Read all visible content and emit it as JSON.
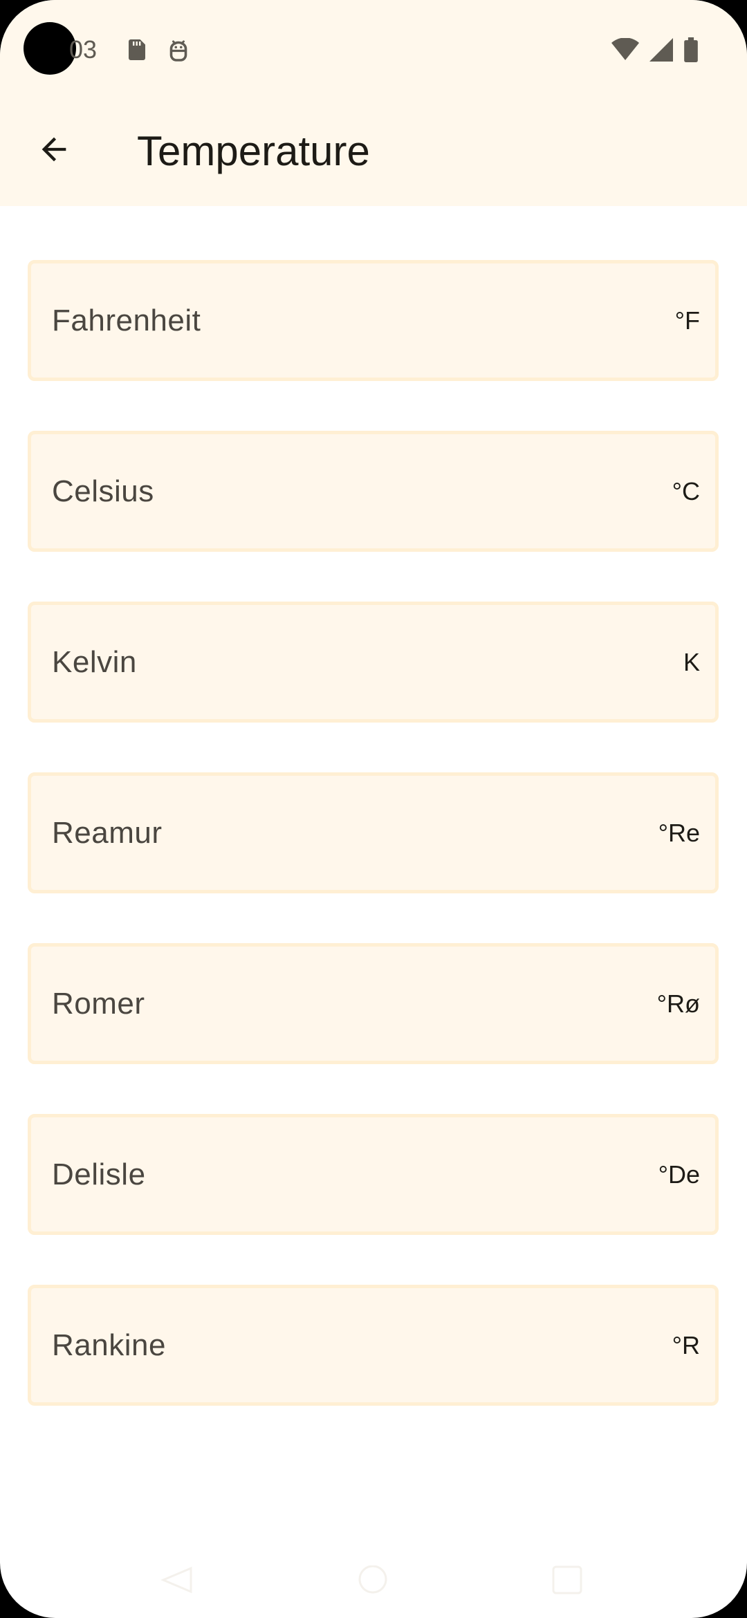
{
  "status_bar": {
    "time": "03",
    "left_icons": [
      "sd-card-icon",
      "android-debug-icon"
    ],
    "right_icons": [
      "wifi-icon",
      "signal-icon",
      "battery-icon"
    ]
  },
  "app_bar": {
    "title": "Temperature",
    "back_icon": "arrow-back-icon"
  },
  "units": [
    {
      "name": "Fahrenheit",
      "symbol": "°F"
    },
    {
      "name": "Celsius",
      "symbol": "°C"
    },
    {
      "name": "Kelvin",
      "symbol": "K"
    },
    {
      "name": "Reamur",
      "symbol": "°Re"
    },
    {
      "name": "Romer",
      "symbol": "°Rø"
    },
    {
      "name": "Delisle",
      "symbol": "°De"
    },
    {
      "name": "Rankine",
      "symbol": "°R"
    }
  ],
  "colors": {
    "header_background": "#FFF8EC",
    "card_background": "#FFF7EB",
    "card_border": "#FFEFD3",
    "title_text": "#1D1B16",
    "label_text": "#4A4640"
  },
  "nav_bar": {
    "buttons": [
      "nav-back-icon",
      "nav-home-icon",
      "nav-recents-icon"
    ]
  }
}
